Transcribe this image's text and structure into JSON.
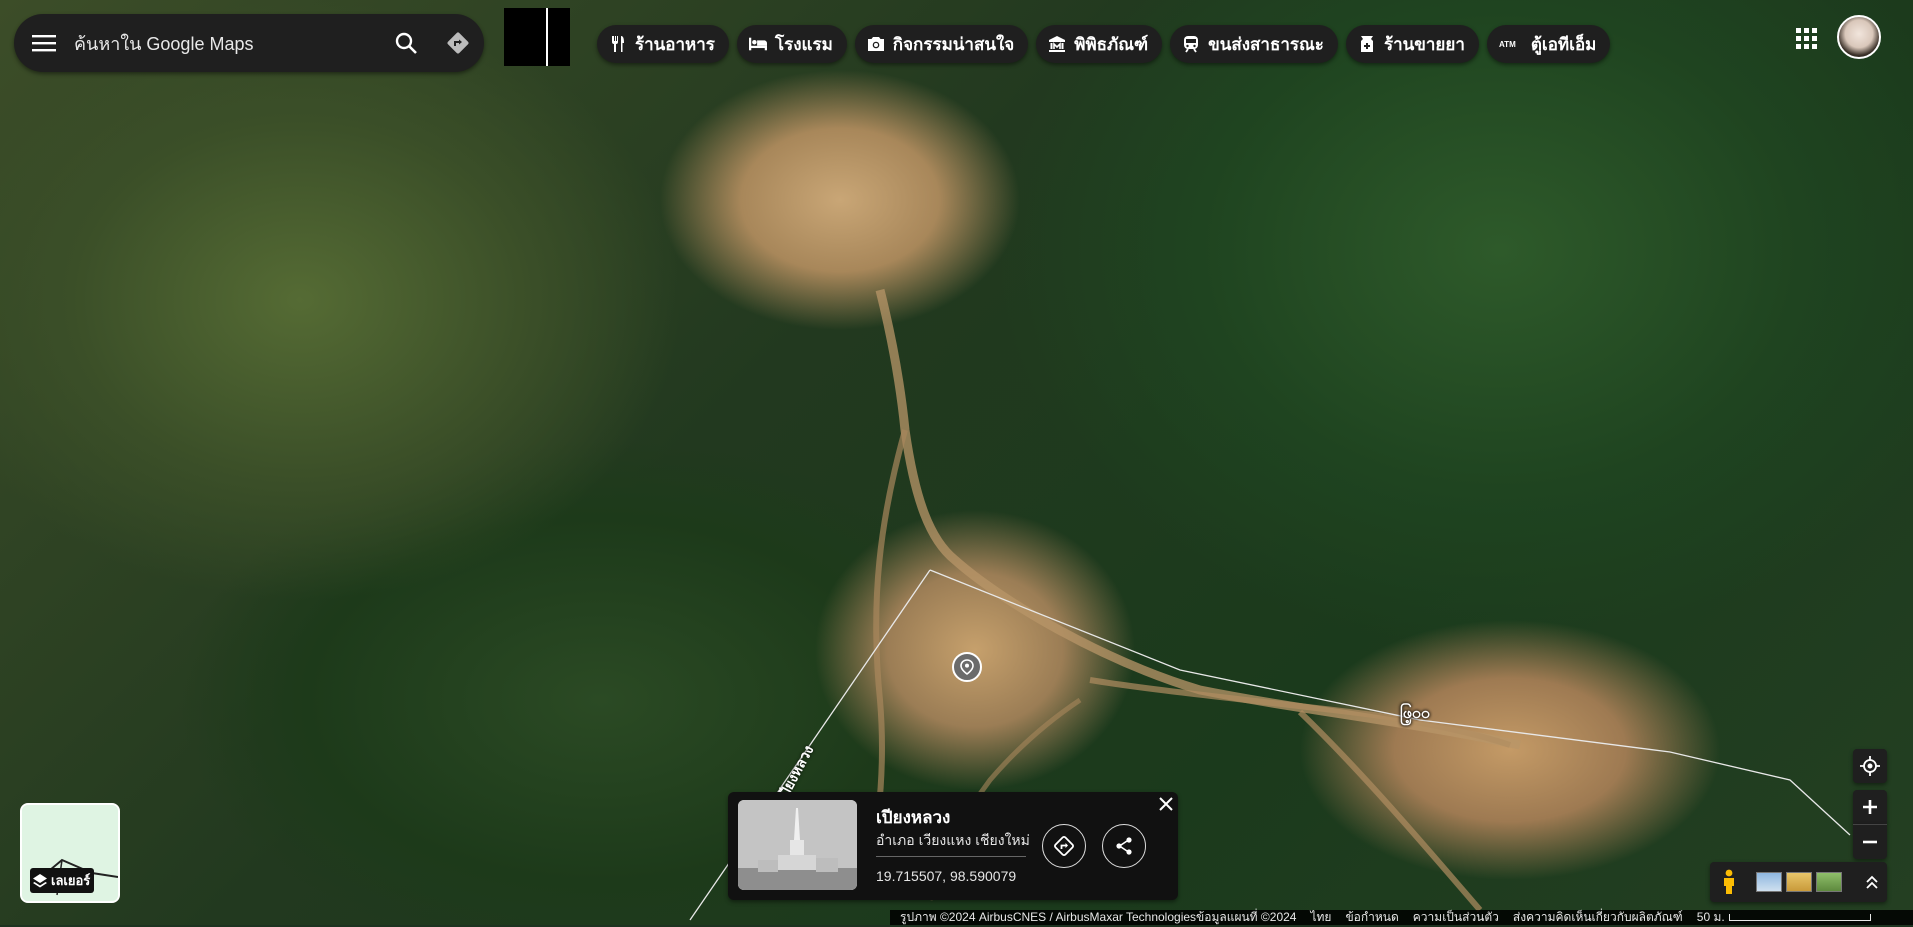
{
  "search": {
    "placeholder": "ค้นหาใน Google Maps"
  },
  "chips": [
    {
      "icon": "restaurant-icon",
      "label": "ร้านอาหาร"
    },
    {
      "icon": "hotel-bed-icon",
      "label": "โรงแรม"
    },
    {
      "icon": "camera-icon",
      "label": "กิจกรรมน่าสนใจ"
    },
    {
      "icon": "museum-icon",
      "label": "พิพิธภัณฑ์"
    },
    {
      "icon": "train-icon",
      "label": "ขนส่งสาธารณะ"
    },
    {
      "icon": "pharmacy-icon",
      "label": "ร้านขายยา"
    },
    {
      "icon": "atm-icon",
      "label": "ตู้เอทีเอ็ม"
    }
  ],
  "map": {
    "place_label": "ဖြ့ဝဝ",
    "road_label": "ถนนเปียงหลวง"
  },
  "card": {
    "title": "เปียงหลวง",
    "subtitle": "อำเภอ เวียงแหง เชียงใหม่",
    "coordinates": "19.715507, 98.590079"
  },
  "layers": {
    "label": "เลเยอร์"
  },
  "footer": {
    "imagery": "รูปภาพ ©2024 AirbusCNES / AirbusMaxar Technologiesข้อมูลแผนที่ ©2024",
    "language": "ไทย",
    "terms": "ข้อกำหนด",
    "privacy": "ความเป็นส่วนตัว",
    "feedback": "ส่งความคิดเห็นเกี่ยวกับผลิตภัณฑ์",
    "scale": "50 ม."
  },
  "colors": {
    "control_bg": "#1f1f1f",
    "card_bg": "#111111",
    "text": "#ffffff"
  }
}
